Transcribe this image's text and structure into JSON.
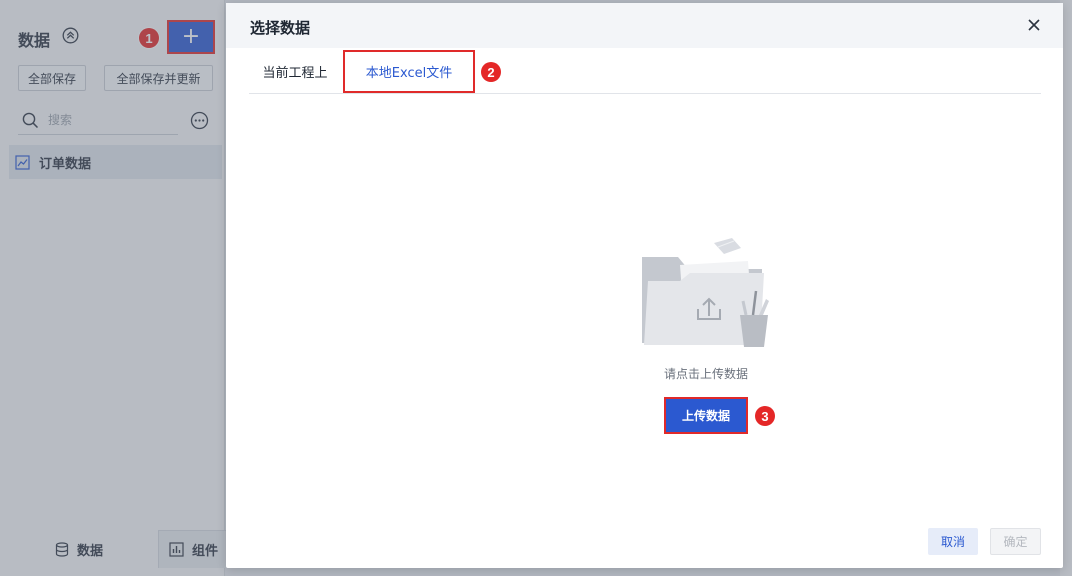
{
  "left_panel": {
    "title": "数据",
    "add_button_label": "+",
    "save_all_label": "全部保存",
    "save_all_update_label": "全部保存并更新",
    "search_placeholder": "搜索",
    "items": [
      {
        "label": "订单数据",
        "icon": "chart-line-icon"
      }
    ],
    "bottom_tabs": [
      {
        "label": "数据",
        "icon": "database-icon"
      },
      {
        "label": "组件",
        "icon": "bar-chart-icon"
      }
    ]
  },
  "dialog": {
    "title": "选择数据",
    "tabs": [
      {
        "label": "当前工程上",
        "active": false
      },
      {
        "label": "本地Excel文件",
        "active": true
      }
    ],
    "empty_hint": "请点击上传数据",
    "upload_label": "上传数据",
    "cancel_label": "取消",
    "confirm_label": "确定"
  },
  "markers": [
    "1",
    "2",
    "3"
  ],
  "colors": {
    "accent": "#2b59d0",
    "highlight_border": "#e02a2a",
    "marker": "#e42727"
  }
}
